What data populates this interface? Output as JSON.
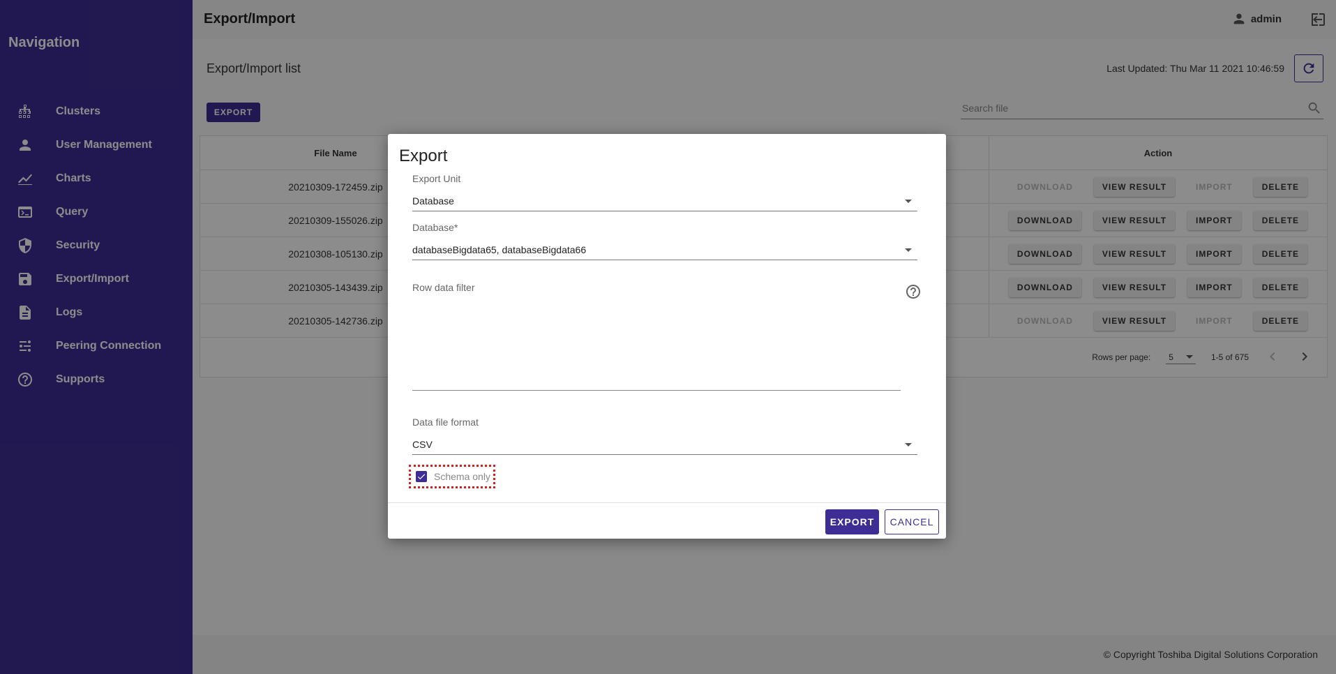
{
  "sidebar": {
    "title": "Navigation",
    "items": [
      {
        "label": "Clusters",
        "icon": "cluster-icon"
      },
      {
        "label": "User Management",
        "icon": "person-icon"
      },
      {
        "label": "Charts",
        "icon": "chart-icon"
      },
      {
        "label": "Query",
        "icon": "terminal-icon"
      },
      {
        "label": "Security",
        "icon": "shield-icon"
      },
      {
        "label": "Export/Import",
        "icon": "save-icon"
      },
      {
        "label": "Logs",
        "icon": "document-icon"
      },
      {
        "label": "Peering Connection",
        "icon": "peering-icon"
      },
      {
        "label": "Supports",
        "icon": "help-icon"
      }
    ]
  },
  "header": {
    "title": "Export/Import",
    "user": "admin"
  },
  "list": {
    "title": "Export/Import list",
    "last_updated": "Last Updated: Thu Mar 11 2021 10:46:59",
    "export_label": "EXPORT",
    "search_placeholder": "Search file"
  },
  "table": {
    "columns": {
      "file_name": "File Name",
      "action": "Action"
    },
    "action_labels": {
      "download": "DOWNLOAD",
      "view_result": "VIEW RESULT",
      "import": "IMPORT",
      "delete": "DELETE"
    },
    "rows": [
      {
        "file": "20210309-172459.zip",
        "enabled": false
      },
      {
        "file": "20210309-155026.zip",
        "enabled": true
      },
      {
        "file": "20210308-105130.zip",
        "enabled": true
      },
      {
        "file": "20210305-143439.zip",
        "enabled": true
      },
      {
        "file": "20210305-142736.zip",
        "enabled": false
      }
    ],
    "footer": {
      "rows_per_page_label": "Rows per page:",
      "rows_per_page": "5",
      "range": "1-5 of 675"
    }
  },
  "footer": {
    "copyright": "© Copyright Toshiba Digital Solutions Corporation"
  },
  "dialog": {
    "title": "Export",
    "export_unit_label": "Export Unit",
    "export_unit_value": "Database",
    "database_label": "Database*",
    "database_value": "databaseBigdata65, databaseBigdata66",
    "row_filter_label": "Row data filter",
    "format_label": "Data file format",
    "format_value": "CSV",
    "schema_only_label": "Schema only",
    "schema_only_checked": true,
    "export_button": "EXPORT",
    "cancel_button": "CANCEL"
  },
  "colors": {
    "primary": "#3e2d94",
    "highlight": "#d62020"
  }
}
